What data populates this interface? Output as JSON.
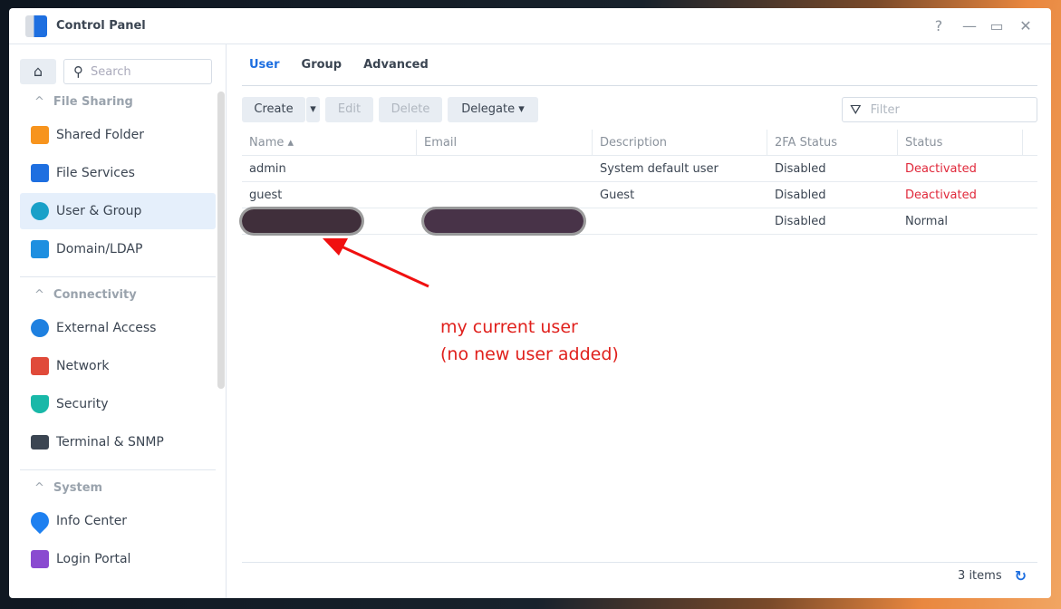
{
  "window": {
    "title": "Control Panel",
    "help": "?",
    "minimize": "—",
    "maximize": "▭",
    "close": "✕"
  },
  "sidebar": {
    "search_placeholder": "Search",
    "sections": [
      {
        "label": "File Sharing"
      },
      {
        "label": "Connectivity"
      },
      {
        "label": "System"
      }
    ],
    "items": [
      {
        "label": "Shared Folder",
        "icon": "folder-icon",
        "color": "#f7941d"
      },
      {
        "label": "File Services",
        "icon": "file-services-icon",
        "color": "#1e6fe0"
      },
      {
        "label": "User & Group",
        "icon": "users-icon",
        "color": "#19a0c8",
        "active": true
      },
      {
        "label": "Domain/LDAP",
        "icon": "domain-icon",
        "color": "#1e8fe0"
      },
      {
        "label": "External Access",
        "icon": "external-access-icon",
        "color": "#1e80e0"
      },
      {
        "label": "Network",
        "icon": "network-icon",
        "color": "#e04a3a"
      },
      {
        "label": "Security",
        "icon": "shield-icon",
        "color": "#19b8a8"
      },
      {
        "label": "Terminal & SNMP",
        "icon": "terminal-icon",
        "color": "#3b4552"
      },
      {
        "label": "Info Center",
        "icon": "info-icon",
        "color": "#1e80f0"
      },
      {
        "label": "Login Portal",
        "icon": "login-portal-icon",
        "color": "#8a4ad0"
      }
    ]
  },
  "tabs": [
    {
      "label": "User",
      "active": true
    },
    {
      "label": "Group"
    },
    {
      "label": "Advanced"
    }
  ],
  "toolbar": {
    "create": "Create",
    "edit": "Edit",
    "delete": "Delete",
    "delegate": "Delegate",
    "filter_placeholder": "Filter"
  },
  "table": {
    "columns": [
      "Name ▴",
      "Email",
      "Description",
      "2FA Status",
      "Status"
    ],
    "rows": [
      {
        "name": "admin",
        "email": "",
        "description": "System default user",
        "tfa": "Disabled",
        "status": "Deactivated"
      },
      {
        "name": "guest",
        "email": "",
        "description": "Guest",
        "tfa": "Disabled",
        "status": "Deactivated"
      },
      {
        "name": "",
        "email": "",
        "description": "",
        "tfa": "Disabled",
        "status": "Normal"
      }
    ]
  },
  "footer": {
    "count": "3 items"
  },
  "annotation": {
    "line1": "my current user",
    "line2": "(no new user added)",
    "color": "#e0201c"
  }
}
